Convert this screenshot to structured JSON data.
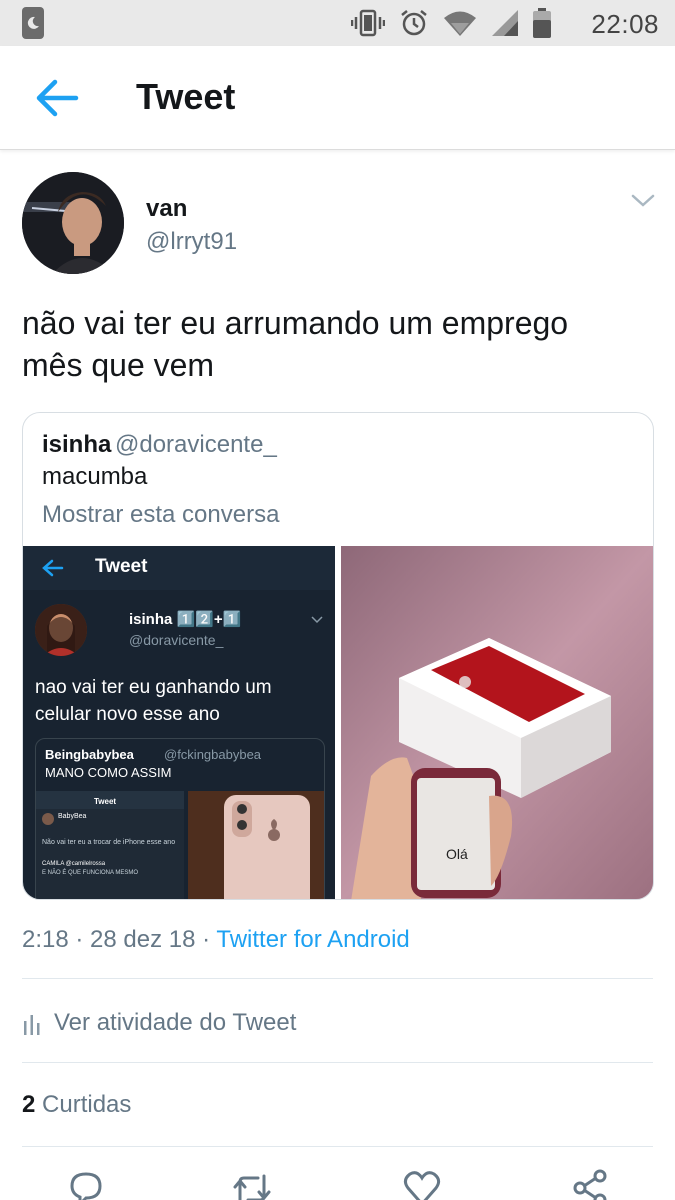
{
  "status_bar": {
    "time": "22:08",
    "icons": [
      "moon-icon",
      "vibrate-icon",
      "alarm-icon",
      "wifi-icon",
      "signal-icon",
      "battery-icon"
    ]
  },
  "app_bar": {
    "title": "Tweet",
    "back_icon": "arrow-left-icon"
  },
  "tweet": {
    "author_name": "van",
    "author_handle": "@lrryt91",
    "text_line1": "não vai ter eu arrumando um emprego",
    "text_line2": "mês que vem",
    "quoted": {
      "name": "isinha",
      "handle": "@doravicente_",
      "text": "macumba",
      "show_conversation": "Mostrar esta conversa",
      "image1": {
        "title": "Tweet",
        "name": "isinha 1️⃣2️⃣+1️⃣",
        "handle": "@doravicente_",
        "text": "nao vai ter eu ganhando um celular novo esse ano",
        "quote_name": "Beingbabybea",
        "quote_handle": "@fckingbabybea",
        "quote_text": "MANO COMO ASSIM",
        "mini_title": "Tweet",
        "mini_name": "BabyBea",
        "mini_text": "Não vai ter eu a trocar de iPhone esse ano",
        "mini_comment_name": "CAMILA @camilelrossa",
        "mini_comment_text": "E NÃO É QUE FUNCIONA MESMO"
      },
      "image2": {
        "phone_text": "Olá"
      }
    },
    "timestamp": "2:18 · 28 dez 18 · ",
    "source": "Twitter for Android",
    "activity_label": "Ver atividade do Tweet",
    "likes_count": "2",
    "likes_label": " Curtidas"
  },
  "colors": {
    "accent": "#1da1f2",
    "secondary_text": "#657786",
    "divider": "#e1e8ed"
  }
}
